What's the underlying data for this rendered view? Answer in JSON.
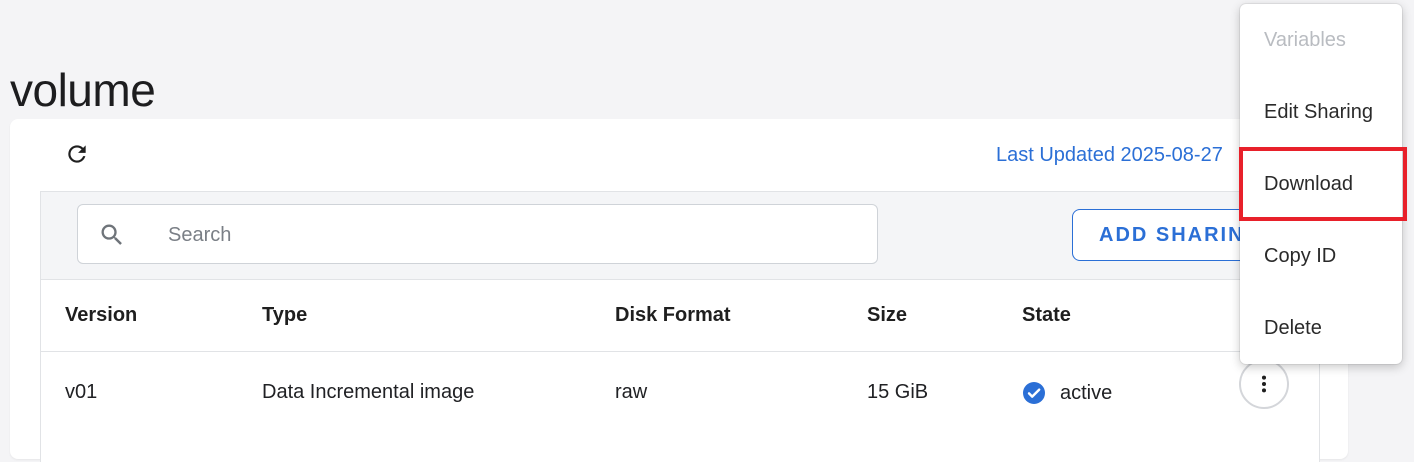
{
  "page": {
    "title": "volume"
  },
  "card": {
    "last_updated": "Last Updated 2025-08-27"
  },
  "search": {
    "placeholder": "Search",
    "value": ""
  },
  "toolbar": {
    "add_sharing_label": "ADD SHARING"
  },
  "table": {
    "columns": [
      "Version",
      "Type",
      "Disk Format",
      "Size",
      "State"
    ],
    "rows": [
      {
        "version": "v01",
        "type": "Data Incremental image",
        "disk_format": "raw",
        "size": "15 GiB",
        "state": "active"
      }
    ]
  },
  "menu": {
    "items": [
      {
        "label": "Variables",
        "enabled": false
      },
      {
        "label": "Edit Sharing",
        "enabled": true
      },
      {
        "label": "Download",
        "enabled": true,
        "highlighted": true
      },
      {
        "label": "Copy ID",
        "enabled": true
      },
      {
        "label": "Delete",
        "enabled": true
      }
    ]
  },
  "icons": {
    "refresh": "refresh-icon",
    "search": "search-icon",
    "state": "check-circle-icon",
    "more": "more-vert-icon"
  },
  "colors": {
    "accent": "#2b6fd6",
    "highlight": "#e8202a",
    "background": "#f4f4f6"
  }
}
